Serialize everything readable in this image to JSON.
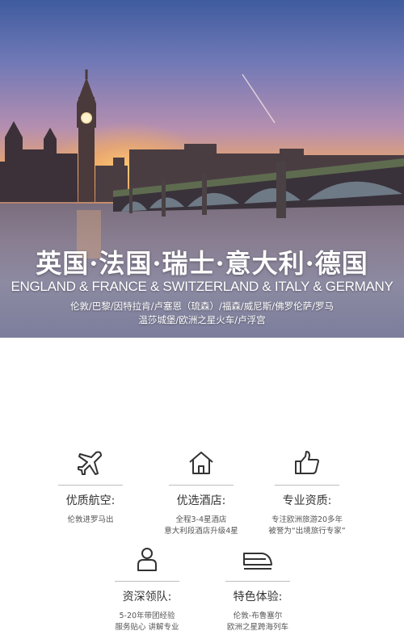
{
  "hero": {
    "title": "英国·法国·瑞士·意大利·德国",
    "subtitle": "ENGLAND & FRANCE & SWITZERLAND & ITALY & GERMANY",
    "cities_line1": "伦敦/巴黎/因特拉肯/卢塞恩（琉森）/福森/威尼斯/佛罗伦萨/罗马",
    "cities_line2": "温莎城堡/欧洲之星火车/卢浮宫"
  },
  "features": [
    {
      "icon": "airplane-icon",
      "title": "优质航空:",
      "desc": [
        "伦敦进罗马出"
      ]
    },
    {
      "icon": "house-icon",
      "title": "优选酒店:",
      "desc": [
        "全程3-4星酒店",
        "意大利段酒店升级4星"
      ]
    },
    {
      "icon": "thumbs-up-icon",
      "title": "专业资质:",
      "desc": [
        "专注欧洲旅游20多年",
        "被誉为“出境旅行专家”"
      ]
    },
    {
      "icon": "person-icon",
      "title": "资深领队:",
      "desc": [
        "5-20年带团经验",
        "服务贴心 讲解专业"
      ]
    },
    {
      "icon": "train-icon",
      "title": "特色体验:",
      "desc": [
        "伦敦-布鲁塞尔",
        "欧洲之星跨海列车"
      ]
    }
  ],
  "colors": {
    "icon": "#333333",
    "divider": "#bdbdbd",
    "hero_text": "#ffffff"
  }
}
